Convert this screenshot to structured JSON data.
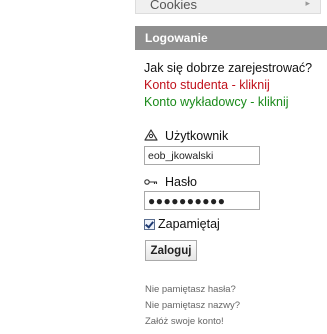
{
  "menu": {
    "items": [
      {
        "label": "Cookies"
      }
    ]
  },
  "login": {
    "title": "Logowanie",
    "register_question": "Jak się dobrze zarejestrować?",
    "student_link": "Konto studenta - kliknij",
    "lecturer_link": "Konto wykładowcy - kliknij",
    "username_label": "Użytkownik",
    "username_value": "eob_jkowalski",
    "password_label": "Hasło",
    "password_value": "●●●●●●●●●●",
    "remember_label": "Zapamiętaj",
    "remember_checked": true,
    "submit_label": "Zaloguj",
    "forgot_password": "Nie pamiętasz hasła?",
    "forgot_username": "Nie pamiętasz nazwy?",
    "create_account": "Załóż swoje konto!"
  },
  "icons": {
    "username_icon": "user-icon",
    "password_icon": "key-icon",
    "menu_chevron": "chevron-right-icon"
  },
  "colors": {
    "header_background": "#8f8f8f",
    "student_link": "#c0121c",
    "lecturer_link": "#1a8a1a"
  }
}
